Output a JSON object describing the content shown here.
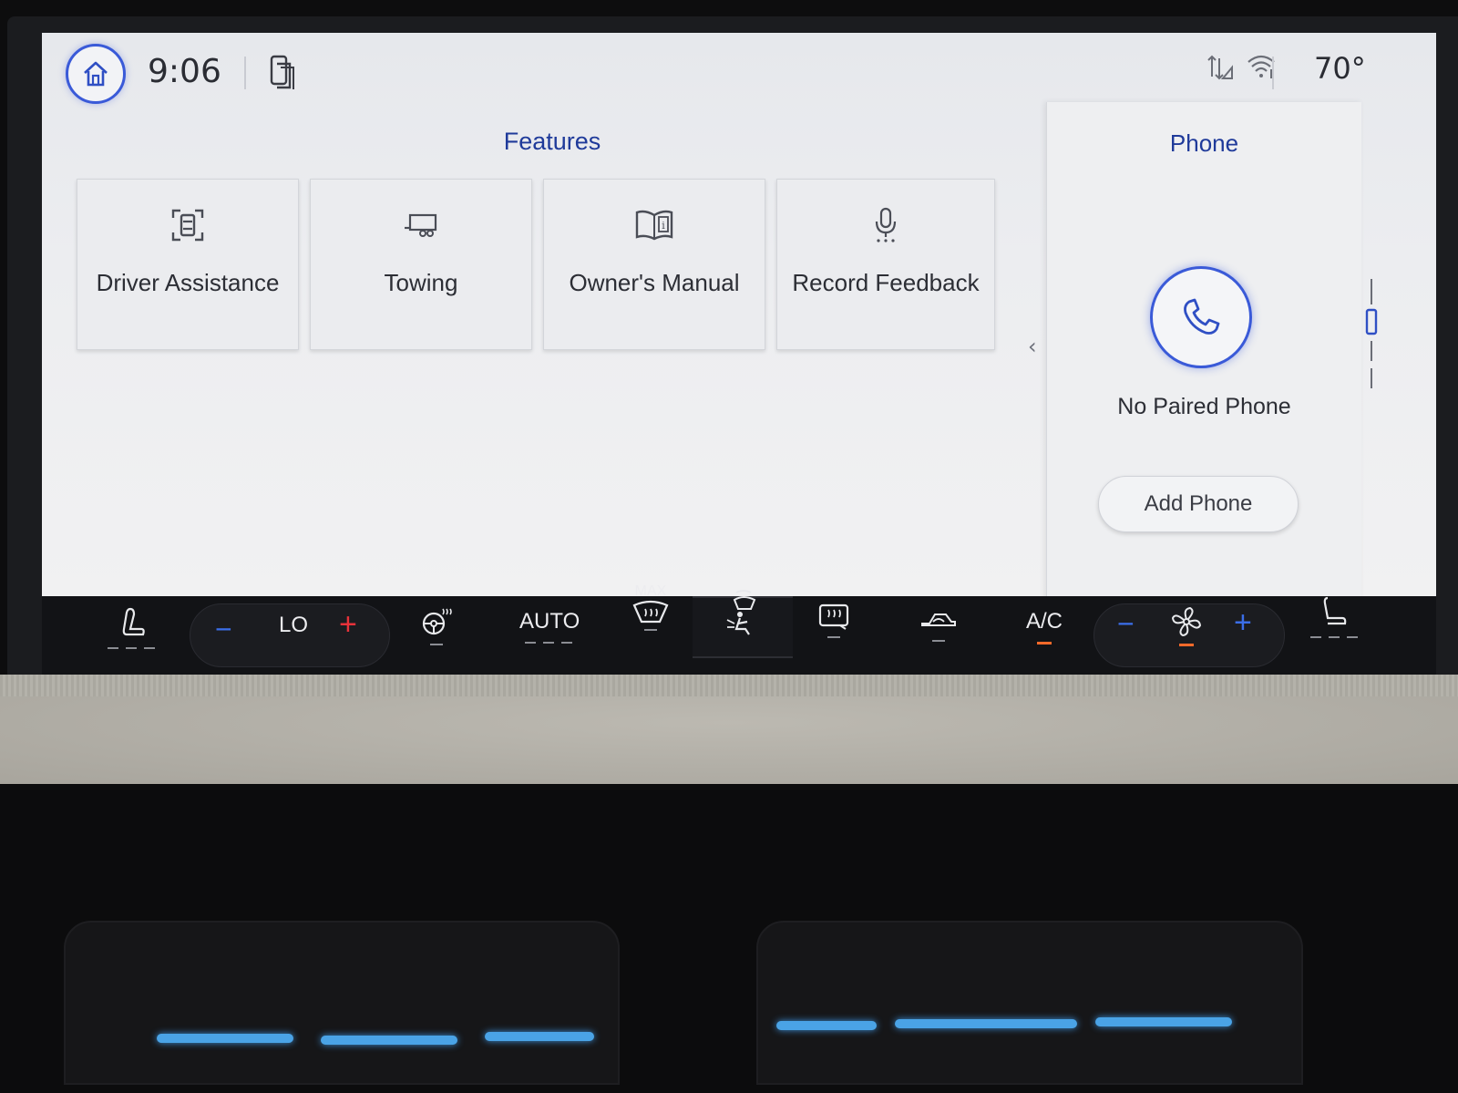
{
  "status_bar": {
    "time": "9:06",
    "temperature": "70°",
    "icons": [
      "home-icon",
      "phone-projection-icon",
      "data-signal-icon",
      "wifi-icon"
    ]
  },
  "features": {
    "title": "Features",
    "tiles": [
      {
        "label": "Driver Assistance",
        "icon": "driver-assistance-icon"
      },
      {
        "label": "Towing",
        "icon": "trailer-icon"
      },
      {
        "label": "Owner's Manual",
        "icon": "manual-book-icon"
      },
      {
        "label": "Record Feedback",
        "icon": "microphone-icon"
      }
    ]
  },
  "phone": {
    "title": "Phone",
    "status": "No Paired Phone",
    "add_button": "Add Phone"
  },
  "climate": {
    "temp_setting": "LO",
    "auto_label": "AUTO",
    "max_label": "MAX",
    "ac_label": "A/C",
    "minus": "−",
    "plus": "+",
    "colors": {
      "minus": "#3b6ee8",
      "plus_temp": "#e8323a",
      "plus_fan": "#3b6ee8",
      "active_indicator": "#ff6a2a"
    }
  }
}
